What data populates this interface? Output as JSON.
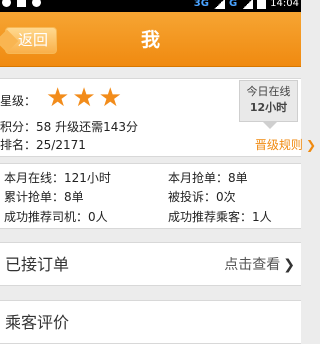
{
  "status_bar": {
    "network_label_1": "3G",
    "network_label_2": "G",
    "time": "14:04"
  },
  "header": {
    "back_label": "返回",
    "title": "我"
  },
  "profile": {
    "level_label": "星级：",
    "stars_count": 3,
    "points_text": "积分：58   升级还需143分",
    "rank_text": "排名：25/2171",
    "online_badge": {
      "line1": "今日在线",
      "line2": "12小时"
    },
    "upgrade_rules": "晋级规则"
  },
  "stats": {
    "month_online": "本月在线：121小时",
    "month_grabbed": "本月抢单：8单",
    "total_grabbed": "累计抢单：8单",
    "complaints": "被投诉：0次",
    "referred_drivers": "成功推荐司机：0人",
    "referred_passengers": "成功推荐乘客：1人"
  },
  "orders_row": {
    "label": "已接订单",
    "action": "点击查看"
  },
  "review_row": {
    "label": "乘客评价"
  },
  "colors": {
    "accent": "#f08a10",
    "star": "#f28c1b"
  }
}
